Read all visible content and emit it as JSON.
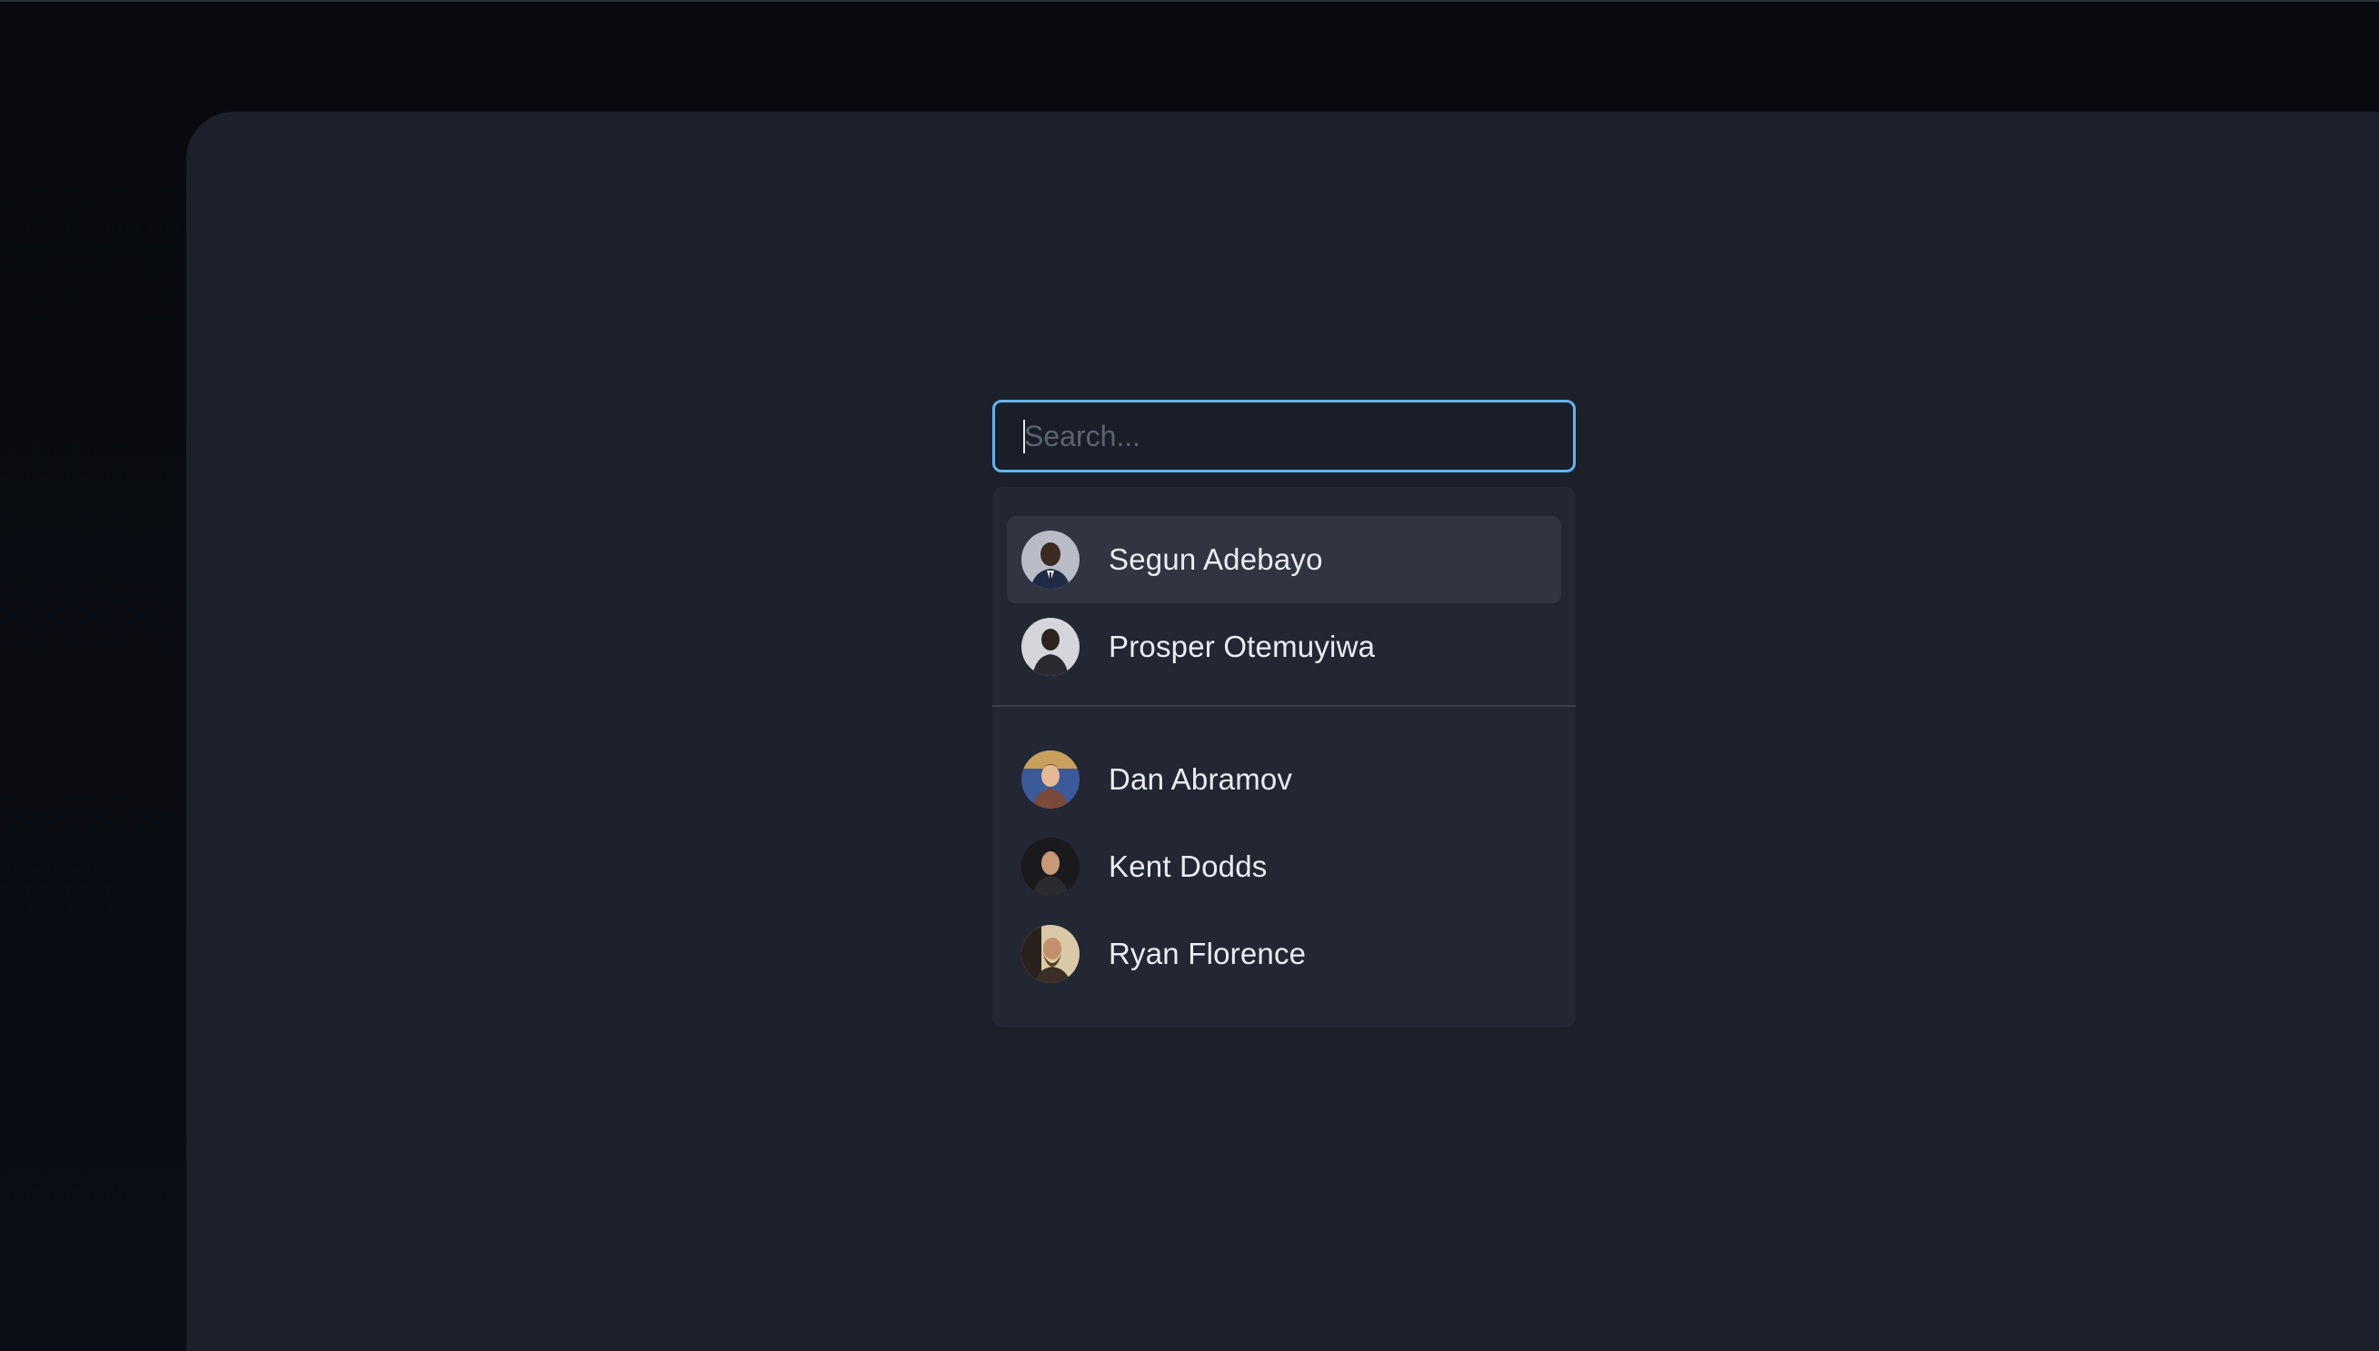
{
  "search": {
    "placeholder": "Search...",
    "value": ""
  },
  "groups": [
    {
      "options": [
        {
          "name": "Segun Adebayo",
          "avatar": "avatar-segun",
          "highlighted": true
        },
        {
          "name": "Prosper Otemuyiwa",
          "avatar": "avatar-prosper",
          "highlighted": false
        }
      ]
    },
    {
      "options": [
        {
          "name": "Dan Abramov",
          "avatar": "avatar-dan",
          "highlighted": false
        },
        {
          "name": "Kent Dodds",
          "avatar": "avatar-kent",
          "highlighted": false
        },
        {
          "name": "Ryan Florence",
          "avatar": "avatar-ryan",
          "highlighted": false
        }
      ]
    }
  ],
  "colors": {
    "focus_ring": "#63b3ed",
    "panel": "#1c202b",
    "listbox": "#232733",
    "highlight": "#313541"
  }
}
